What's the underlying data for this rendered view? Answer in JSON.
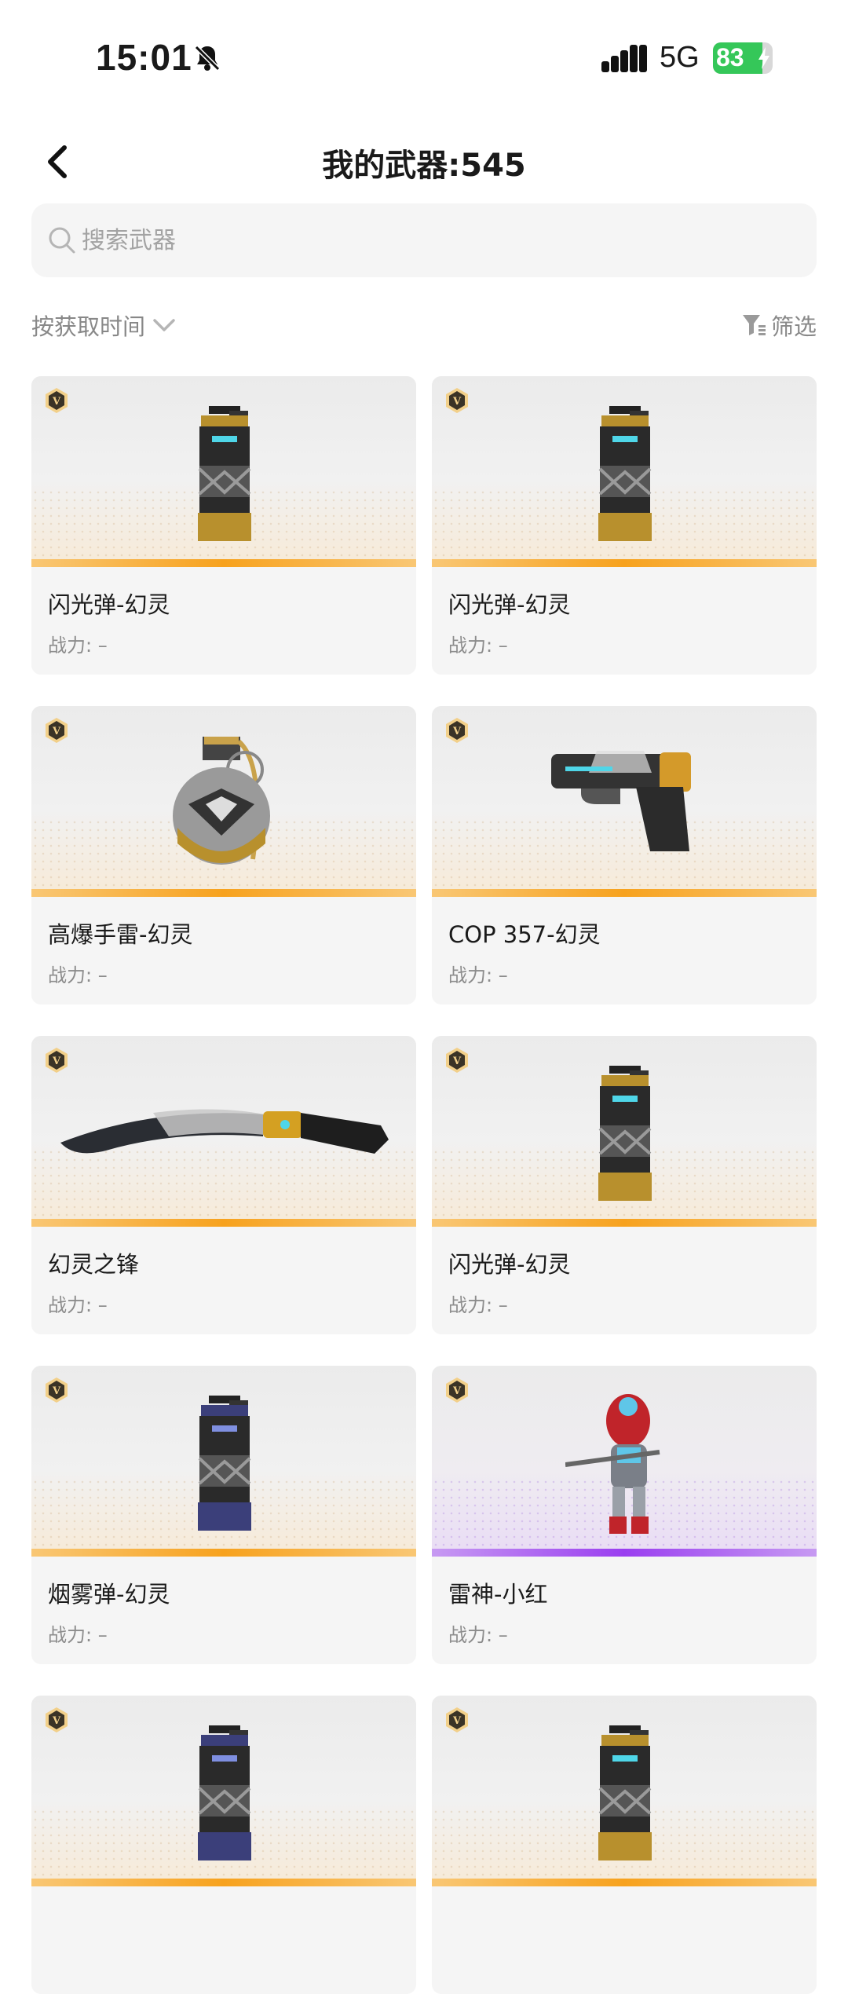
{
  "status": {
    "time": "15:01",
    "network": "5G",
    "battery": "83",
    "battery_level": 0.83,
    "icons": [
      "bell-slash-icon",
      "signal-icon",
      "battery-icon",
      "charging-bolt-icon"
    ]
  },
  "header": {
    "title": "我的武器:545",
    "back_icon": "chevron-left-icon"
  },
  "search": {
    "placeholder": "搜索武器",
    "icon": "search-icon"
  },
  "toolbar": {
    "sort_label": "按获取时间",
    "filter_label": "筛选"
  },
  "colors": {
    "gold_rarity": "#f7a21e",
    "purple_rarity": "#9a3ef0",
    "card_bg": "#f5f5f5",
    "battery_green": "#35c759"
  },
  "weapons": [
    {
      "name": "闪光弹-幻灵",
      "power": "战力: –",
      "rarity": "gold",
      "art": "flashbang-icon"
    },
    {
      "name": "闪光弹-幻灵",
      "power": "战力: –",
      "rarity": "gold",
      "art": "flashbang-icon"
    },
    {
      "name": "高爆手雷-幻灵",
      "power": "战力: –",
      "rarity": "gold",
      "art": "grenade-icon"
    },
    {
      "name": "COP 357-幻灵",
      "power": "战力: –",
      "rarity": "gold",
      "art": "pistol-icon"
    },
    {
      "name": "幻灵之锋",
      "power": "战力: –",
      "rarity": "gold",
      "art": "kukri-knife-icon"
    },
    {
      "name": "闪光弹-幻灵",
      "power": "战力: –",
      "rarity": "gold",
      "art": "flashbang-icon"
    },
    {
      "name": "烟雾弹-幻灵",
      "power": "战力: –",
      "rarity": "gold",
      "art": "smoke-grenade-icon"
    },
    {
      "name": "雷神-小红",
      "power": "战力: –",
      "rarity": "purple",
      "art": "character-icon"
    },
    {
      "name": "",
      "power": "",
      "rarity": "gold",
      "art": "smoke-grenade-icon"
    },
    {
      "name": "",
      "power": "",
      "rarity": "gold",
      "art": "flashbang-icon"
    }
  ]
}
